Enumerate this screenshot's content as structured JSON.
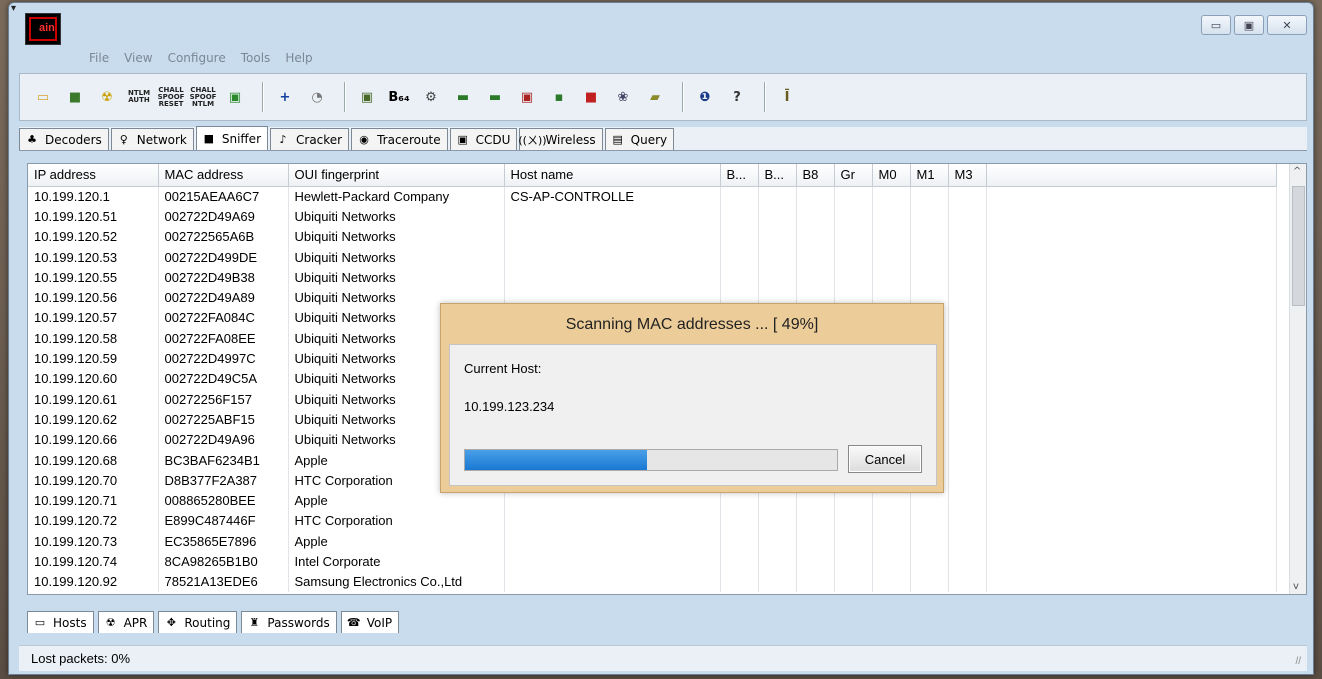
{
  "app": {
    "icon_text": "ain"
  },
  "menu": [
    "File",
    "View",
    "Configure",
    "Tools",
    "Help"
  ],
  "window_buttons": {
    "minimize": "▭",
    "maximize": "▣",
    "close": "✕"
  },
  "toolbar_icons": [
    {
      "name": "open-folder-icon",
      "glyph": "▭",
      "color": "#d8a530"
    },
    {
      "name": "sniffer-icon",
      "glyph": "■",
      "color": "#3a7a2a"
    },
    {
      "name": "apr-icon",
      "glyph": "☢",
      "color": "#c8a000"
    },
    {
      "name": "ntlm-auth-icon",
      "glyph": "NTLM AUTH",
      "small": true
    },
    {
      "name": "chall-spoof-reset-icon",
      "glyph": "CHALL SPOOF RESET",
      "small": true
    },
    {
      "name": "chall-spoof-ntlm-icon",
      "glyph": "CHALL SPOOF NTLM",
      "small": true
    },
    {
      "name": "certificate-icon",
      "glyph": "▣",
      "color": "#2a8a2a"
    },
    {
      "sep": true
    },
    {
      "name": "add-icon",
      "glyph": "+",
      "color": "#1040a0"
    },
    {
      "name": "remove-icon",
      "glyph": "◔",
      "color": "#777"
    },
    {
      "sep": true
    },
    {
      "name": "network-scan-icon",
      "glyph": "▣",
      "color": "#4a6a2a"
    },
    {
      "name": "base64-icon",
      "glyph": "B₆₄",
      "color": "#000"
    },
    {
      "name": "tools-icon",
      "glyph": "⚙",
      "color": "#444"
    },
    {
      "name": "lsa-secrets-icon",
      "glyph": "▬",
      "color": "#2a7a2a"
    },
    {
      "name": "vpn-icon",
      "glyph": "▬",
      "color": "#2a7a2a"
    },
    {
      "name": "rdp-icon",
      "glyph": "▣",
      "color": "#aa2222"
    },
    {
      "name": "cisco-icon",
      "glyph": "▪",
      "color": "#2a7a2a"
    },
    {
      "name": "box-icon",
      "glyph": "■",
      "color": "#c02020"
    },
    {
      "name": "wireless-icon",
      "glyph": "❀",
      "color": "#446"
    },
    {
      "name": "key-icon",
      "glyph": "▰",
      "color": "#8a8a2a"
    },
    {
      "sep": true
    },
    {
      "name": "info-icon",
      "glyph": "❶",
      "color": "#1a3a8a"
    },
    {
      "name": "help-icon",
      "glyph": "?",
      "color": "#333"
    },
    {
      "sep": true
    },
    {
      "name": "exit-icon",
      "glyph": "Ī",
      "color": "#6a5a20"
    }
  ],
  "top_tabs": [
    {
      "id": "decoders",
      "label": "Decoders",
      "icon": "decoders-icon",
      "glyph": "♣",
      "active": false
    },
    {
      "id": "network",
      "label": "Network",
      "icon": "network-icon",
      "glyph": "♀",
      "active": false
    },
    {
      "id": "sniffer",
      "label": "Sniffer",
      "icon": "sniffer-tab-icon",
      "glyph": "■",
      "active": true
    },
    {
      "id": "cracker",
      "label": "Cracker",
      "icon": "cracker-icon",
      "glyph": "♪",
      "active": false
    },
    {
      "id": "traceroute",
      "label": "Traceroute",
      "icon": "traceroute-icon",
      "glyph": "◉",
      "active": false
    },
    {
      "id": "ccdu",
      "label": "CCDU",
      "icon": "ccdu-icon",
      "glyph": "▣",
      "active": false
    },
    {
      "id": "wireless",
      "label": "Wireless",
      "icon": "wireless-tab-icon",
      "glyph": "((ㄨ))",
      "active": false
    },
    {
      "id": "query",
      "label": "Query",
      "icon": "query-icon",
      "glyph": "▤",
      "active": false
    }
  ],
  "table": {
    "columns": [
      "IP address",
      "MAC address",
      "OUI fingerprint",
      "Host name",
      "B...",
      "B...",
      "B8",
      "Gr",
      "M0",
      "M1",
      "M3"
    ],
    "rows": [
      [
        "10.199.120.1",
        "00215AEAA6C7",
        "Hewlett-Packard Company",
        "CS-AP-CONTROLLE"
      ],
      [
        "10.199.120.51",
        "002722D49A69",
        "Ubiquiti Networks",
        ""
      ],
      [
        "10.199.120.52",
        "002722565A6B",
        "Ubiquiti Networks",
        ""
      ],
      [
        "10.199.120.53",
        "002722D499DE",
        "Ubiquiti Networks",
        ""
      ],
      [
        "10.199.120.55",
        "002722D49B38",
        "Ubiquiti Networks",
        ""
      ],
      [
        "10.199.120.56",
        "002722D49A89",
        "Ubiquiti Networks",
        ""
      ],
      [
        "10.199.120.57",
        "002722FA084C",
        "Ubiquiti Networks",
        ""
      ],
      [
        "10.199.120.58",
        "002722FA08EE",
        "Ubiquiti Networks",
        ""
      ],
      [
        "10.199.120.59",
        "002722D4997C",
        "Ubiquiti Networks",
        ""
      ],
      [
        "10.199.120.60",
        "002722D49C5A",
        "Ubiquiti Networks",
        ""
      ],
      [
        "10.199.120.61",
        "00272256F157",
        "Ubiquiti Networks",
        ""
      ],
      [
        "10.199.120.62",
        "0027225ABF15",
        "Ubiquiti Networks",
        ""
      ],
      [
        "10.199.120.66",
        "002722D49A96",
        "Ubiquiti Networks",
        ""
      ],
      [
        "10.199.120.68",
        "BC3BAF6234B1",
        "Apple",
        ""
      ],
      [
        "10.199.120.70",
        "D8B377F2A387",
        "HTC Corporation",
        ""
      ],
      [
        "10.199.120.71",
        "008865280BEE",
        "Apple",
        ""
      ],
      [
        "10.199.120.72",
        "E899C487446F",
        "HTC Corporation",
        ""
      ],
      [
        "10.199.120.73",
        "EC35865E7896",
        "Apple",
        ""
      ],
      [
        "10.199.120.74",
        "8CA98265B1B0",
        "Intel Corporate",
        ""
      ],
      [
        "10.199.120.92",
        "78521A13EDE6",
        "Samsung Electronics Co.,Ltd",
        ""
      ]
    ]
  },
  "bottom_tabs": [
    {
      "id": "hosts",
      "label": "Hosts",
      "icon": "hosts-icon",
      "glyph": "▭"
    },
    {
      "id": "apr",
      "label": "APR",
      "icon": "apr-tab-icon",
      "glyph": "☢"
    },
    {
      "id": "routing",
      "label": "Routing",
      "icon": "routing-icon",
      "glyph": "✥"
    },
    {
      "id": "passwords",
      "label": "Passwords",
      "icon": "passwords-icon",
      "glyph": "♜"
    },
    {
      "id": "voip",
      "label": "VoIP",
      "icon": "voip-icon",
      "glyph": "☎"
    }
  ],
  "status": {
    "lost_packets": "Lost packets:  0%"
  },
  "dialog": {
    "title": "Scanning MAC addresses ... [ 49%]",
    "current_host_label": "Current Host:",
    "current_host": "10.199.123.234",
    "progress": 0.49,
    "cancel_label": "Cancel"
  },
  "scroll": {
    "up": "^",
    "down": "v"
  },
  "resize_grip": "//"
}
